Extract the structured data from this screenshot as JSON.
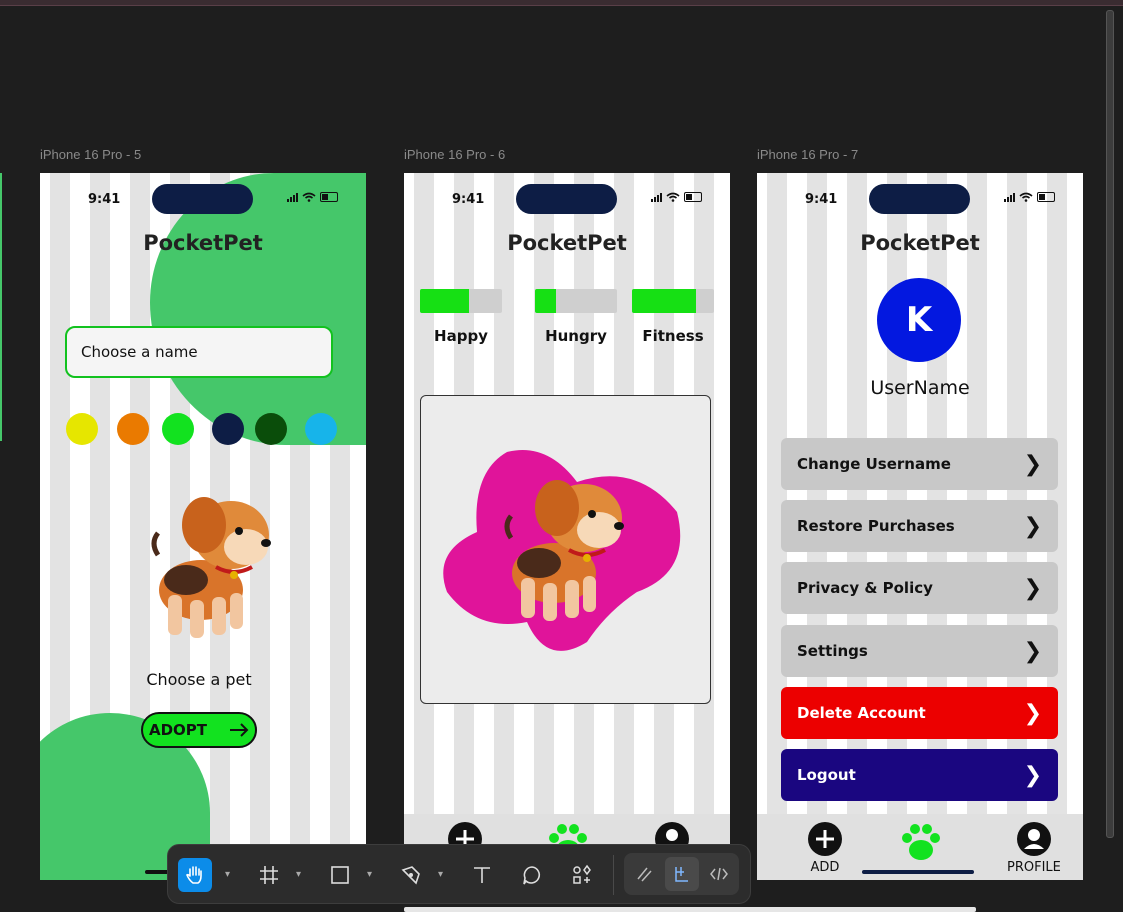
{
  "frames": [
    {
      "label": "iPhone 16 Pro - 5"
    },
    {
      "label": "iPhone 16 Pro - 6"
    },
    {
      "label": "iPhone 16 Pro - 7"
    }
  ],
  "status": {
    "time": "9:41"
  },
  "app": {
    "title": "PocketPet"
  },
  "screen5": {
    "name_input": "Choose a name",
    "swatches": [
      "#e6e600",
      "#ea7a00",
      "#12e21f",
      "#0d1d45",
      "#0a4d0a",
      "#17b4ea"
    ],
    "choose_pet": "Choose a pet",
    "adopt_label": "ADOPT"
  },
  "screen6": {
    "stats": [
      {
        "label": "Happy",
        "value": 0.6
      },
      {
        "label": "Hungry",
        "value": 0.25
      },
      {
        "label": "Fitness",
        "value": 0.78
      }
    ]
  },
  "screen7": {
    "avatar_initial": "K",
    "username": "UserName",
    "menu": [
      {
        "label": "Change Username",
        "color": "#c8c8c8"
      },
      {
        "label": "Restore Purchases",
        "color": "#c8c8c8"
      },
      {
        "label": "Privacy & Policy",
        "color": "#c8c8c8"
      },
      {
        "label": "Settings",
        "color": "#c8c8c8"
      },
      {
        "label": "Delete Account",
        "color": "#ec0000"
      },
      {
        "label": "Logout",
        "color": "#1a0680"
      }
    ],
    "tabs": {
      "add": "ADD",
      "profile": "PROFILE"
    }
  },
  "toolbar": {
    "tools": [
      "hand-tool",
      "frame-tool",
      "rectangle-tool",
      "pen-tool",
      "text-tool",
      "comment-tool",
      "components-tool"
    ],
    "modes": [
      "draw-mode",
      "design-mode",
      "dev-mode"
    ]
  },
  "colors": {
    "accent": "#12e21f",
    "brand_blue": "#0318e0",
    "blob_green": "#45c76a",
    "pink": "#e0149a"
  }
}
